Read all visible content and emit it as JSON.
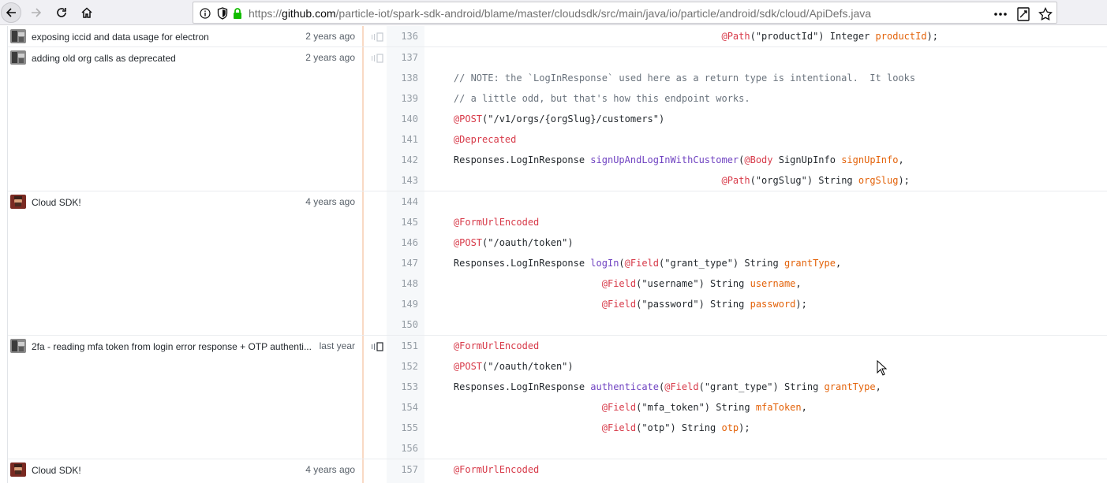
{
  "browser": {
    "url_prefix": "https://",
    "url_host": "github.com",
    "url_path": "/particle-iot/spark-sdk-android/blame/master/cloudsdk/src/main/java/io/particle/android/sdk/cloud/ApiDefs.java"
  },
  "colors": {
    "annotation": "#d73a49",
    "string": "#032f62",
    "parameter": "#e36209",
    "function": "#6f42c1",
    "comment": "#6a737d",
    "blame_border": "#f9d9c4"
  },
  "hunks": [
    {
      "message": "exposing iccid and data usage for electron",
      "age": "2 years ago"
    },
    {
      "message": "adding old org calls as deprecated",
      "age": "2 years ago"
    },
    {
      "message": "Cloud SDK!",
      "age": "4 years ago"
    },
    {
      "message": "2fa - reading mfa token from login error response + OTP authenti...",
      "age": "last year"
    },
    {
      "message": "Cloud SDK!",
      "age": "4 years ago"
    }
  ],
  "lines": [
    {
      "n": "136",
      "tokens": [
        {
          "t": "                                                   "
        },
        {
          "t": "@Path",
          "c": "ann"
        },
        {
          "t": "(\"productId\") Integer "
        },
        {
          "t": "productId",
          "c": "param"
        },
        {
          "t": ");"
        }
      ]
    },
    {
      "n": "137",
      "tokens": []
    },
    {
      "n": "138",
      "tokens": [
        {
          "t": "    "
        },
        {
          "t": "// NOTE: the `LogInResponse` used here as a return type is intentional.  It looks",
          "c": "cmt"
        }
      ]
    },
    {
      "n": "139",
      "tokens": [
        {
          "t": "    "
        },
        {
          "t": "// a little odd, but that's how this endpoint works.",
          "c": "cmt"
        }
      ]
    },
    {
      "n": "140",
      "tokens": [
        {
          "t": "    "
        },
        {
          "t": "@POST",
          "c": "ann"
        },
        {
          "t": "(\"/v1/orgs/{orgSlug}/customers\")"
        }
      ]
    },
    {
      "n": "141",
      "tokens": [
        {
          "t": "    "
        },
        {
          "t": "@Deprecated",
          "c": "ann"
        }
      ]
    },
    {
      "n": "142",
      "tokens": [
        {
          "t": "    Responses.LogInResponse "
        },
        {
          "t": "signUpAndLogInWithCustomer",
          "c": "fn"
        },
        {
          "t": "("
        },
        {
          "t": "@Body",
          "c": "ann"
        },
        {
          "t": " SignUpInfo "
        },
        {
          "t": "signUpInfo",
          "c": "param"
        },
        {
          "t": ","
        }
      ]
    },
    {
      "n": "143",
      "tokens": [
        {
          "t": "                                                   "
        },
        {
          "t": "@Path",
          "c": "ann"
        },
        {
          "t": "(\"orgSlug\") String "
        },
        {
          "t": "orgSlug",
          "c": "param"
        },
        {
          "t": ");"
        }
      ]
    },
    {
      "n": "144",
      "tokens": []
    },
    {
      "n": "145",
      "tokens": [
        {
          "t": "    "
        },
        {
          "t": "@FormUrlEncoded",
          "c": "ann"
        }
      ]
    },
    {
      "n": "146",
      "tokens": [
        {
          "t": "    "
        },
        {
          "t": "@POST",
          "c": "ann"
        },
        {
          "t": "(\"/oauth/token\")"
        }
      ]
    },
    {
      "n": "147",
      "tokens": [
        {
          "t": "    Responses.LogInResponse "
        },
        {
          "t": "logIn",
          "c": "fn"
        },
        {
          "t": "("
        },
        {
          "t": "@Field",
          "c": "ann"
        },
        {
          "t": "(\"grant_type\") String "
        },
        {
          "t": "grantType",
          "c": "param"
        },
        {
          "t": ","
        }
      ]
    },
    {
      "n": "148",
      "tokens": [
        {
          "t": "                              "
        },
        {
          "t": "@Field",
          "c": "ann"
        },
        {
          "t": "(\"username\") String "
        },
        {
          "t": "username",
          "c": "param"
        },
        {
          "t": ","
        }
      ]
    },
    {
      "n": "149",
      "tokens": [
        {
          "t": "                              "
        },
        {
          "t": "@Field",
          "c": "ann"
        },
        {
          "t": "(\"password\") String "
        },
        {
          "t": "password",
          "c": "param"
        },
        {
          "t": ");"
        }
      ]
    },
    {
      "n": "150",
      "tokens": []
    },
    {
      "n": "151",
      "tokens": [
        {
          "t": "    "
        },
        {
          "t": "@FormUrlEncoded",
          "c": "ann"
        }
      ]
    },
    {
      "n": "152",
      "tokens": [
        {
          "t": "    "
        },
        {
          "t": "@POST",
          "c": "ann"
        },
        {
          "t": "(\"/oauth/token\")"
        }
      ]
    },
    {
      "n": "153",
      "tokens": [
        {
          "t": "    Responses.LogInResponse "
        },
        {
          "t": "authenticate",
          "c": "fn"
        },
        {
          "t": "("
        },
        {
          "t": "@Field",
          "c": "ann"
        },
        {
          "t": "(\"grant_type\") String "
        },
        {
          "t": "grantType",
          "c": "param"
        },
        {
          "t": ","
        }
      ]
    },
    {
      "n": "154",
      "tokens": [
        {
          "t": "                              "
        },
        {
          "t": "@Field",
          "c": "ann"
        },
        {
          "t": "(\"mfa_token\") String "
        },
        {
          "t": "mfaToken",
          "c": "param"
        },
        {
          "t": ","
        }
      ]
    },
    {
      "n": "155",
      "tokens": [
        {
          "t": "                              "
        },
        {
          "t": "@Field",
          "c": "ann"
        },
        {
          "t": "(\"otp\") String "
        },
        {
          "t": "otp",
          "c": "param"
        },
        {
          "t": ");"
        }
      ]
    },
    {
      "n": "156",
      "tokens": []
    },
    {
      "n": "157",
      "tokens": [
        {
          "t": "    "
        },
        {
          "t": "@FormUrlEncoded",
          "c": "ann"
        }
      ]
    }
  ]
}
